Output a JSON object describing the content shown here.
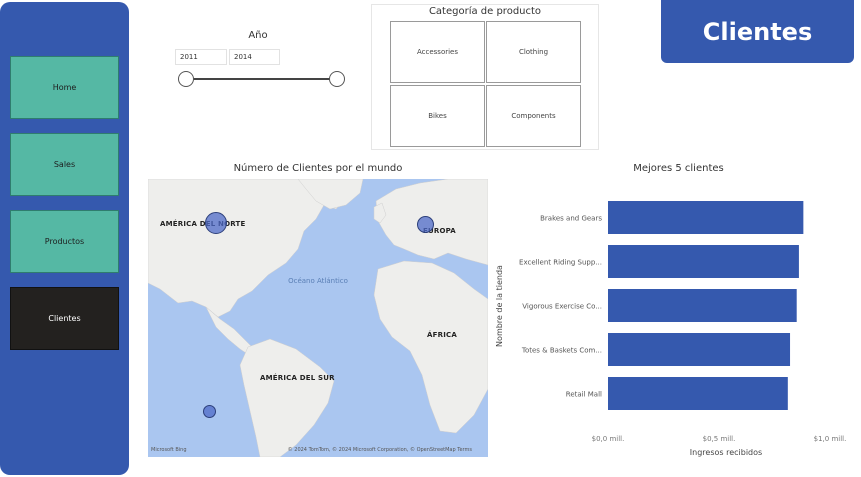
{
  "nav": {
    "items": [
      {
        "label": "Home",
        "active": false
      },
      {
        "label": "Sales",
        "active": false
      },
      {
        "label": "Productos",
        "active": false
      },
      {
        "label": "Clientes",
        "active": true
      }
    ]
  },
  "year_slicer": {
    "title": "Año",
    "start": "2011",
    "end": "2014"
  },
  "category_slicer": {
    "title": "Categoría de producto",
    "options": [
      "Accessories",
      "Clothing",
      "Bikes",
      "Components"
    ]
  },
  "header": {
    "title": "Clientes"
  },
  "map": {
    "title": "Número de Clientes por el mundo",
    "labels": {
      "north_america": "AMÉRICA DEL NORTE",
      "europe": "EUROPA",
      "africa": "ÁFRICA",
      "south_america": "AMÉRICA DEL SUR",
      "ocean": "Océano Atlántico"
    },
    "attribution_left": "Microsoft Bing",
    "attribution_right": "© 2024 TomTom, © 2024 Microsoft Corporation, © OpenStreetMap  Terms",
    "colors": {
      "bubble": "#4e69c8",
      "water": "#aac6f0",
      "land": "#eeeeec"
    }
  },
  "chart_data": {
    "type": "bar",
    "orientation": "horizontal",
    "title": "Mejores 5 clientes",
    "xlabel": "Ingresos recibidos",
    "ylabel": "Nombre de la tienda",
    "categories": [
      "Brakes and Gears",
      "Excellent Riding Supp...",
      "Vigorous Exercise Co...",
      "Totes & Baskets Com...",
      "Retail Mall"
    ],
    "values": [
      0.88,
      0.86,
      0.85,
      0.82,
      0.81
    ],
    "unit": "mill.",
    "xlim": [
      0,
      1.0
    ],
    "x_ticks": [
      "$0,0 mill.",
      "$0,5 mill.",
      "$1,0 mill."
    ],
    "x_tick_values": [
      0,
      0.5,
      1.0
    ],
    "color": "#3559ae"
  }
}
